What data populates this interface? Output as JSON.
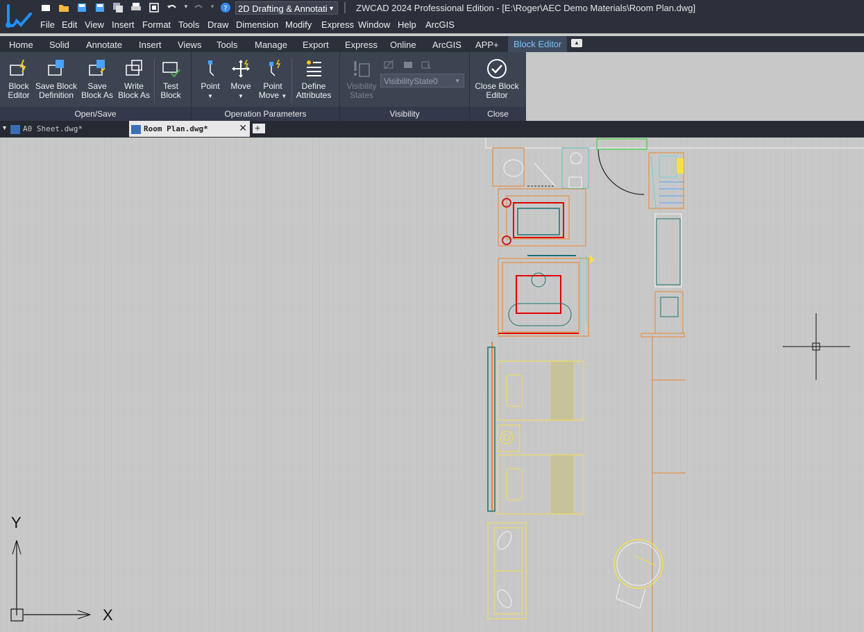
{
  "app": {
    "title": "ZWCAD 2024 Professional Edition - [E:\\Roger\\AEC Demo Materials\\Room Plan.dwg]",
    "workspace": "2D Drafting & Annotati"
  },
  "menu": [
    "File",
    "Edit",
    "View",
    "Insert",
    "Format",
    "Tools",
    "Draw",
    "Dimension",
    "Modify",
    "Express",
    "Window",
    "Help",
    "ArcGIS"
  ],
  "ribbon_tabs": [
    "Home",
    "Solid",
    "Annotate",
    "Insert",
    "Views",
    "Tools",
    "Manage",
    "Export",
    "Express",
    "Online",
    "ArcGIS",
    "APP+",
    "Block Editor"
  ],
  "ribbon": {
    "open_save": {
      "label": "Open/Save",
      "block_editor": [
        "Block",
        "Editor"
      ],
      "save_block_def": [
        "Save Block",
        "Definition"
      ],
      "save_block_as": [
        "Save",
        "Block As"
      ],
      "write_block_as": [
        "Write",
        "Block As"
      ],
      "test_block": [
        "Test",
        "Block"
      ]
    },
    "operation": {
      "label": "Operation Parameters",
      "point": "Point",
      "move": "Move",
      "point_move": [
        "Point",
        "Move"
      ],
      "define_attr": [
        "Define",
        "Attributes"
      ]
    },
    "visibility": {
      "label": "Visibility",
      "states": [
        "Visibility",
        "States"
      ],
      "state_value": "VisibilityState0"
    },
    "close": {
      "label": "Close",
      "close_editor": [
        "Close Block",
        "Editor"
      ]
    }
  },
  "doc_tabs": {
    "tab1": "A0 Sheet.dwg*",
    "tab2": "Room Plan.dwg*"
  },
  "ucs": {
    "y": "Y",
    "x": "X"
  }
}
